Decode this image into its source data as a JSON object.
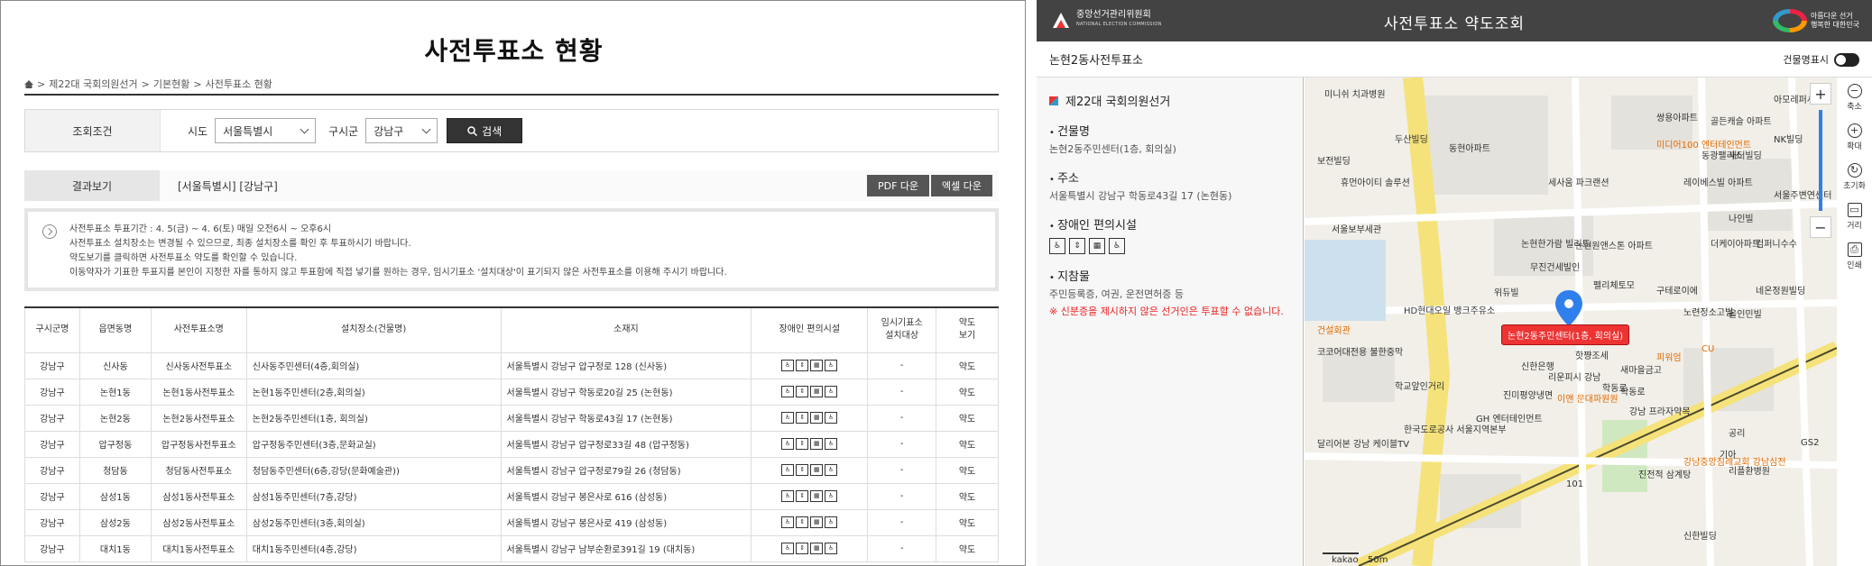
{
  "left": {
    "title": "사전투표소 현황",
    "breadcrumb": [
      "제22대 국회의원선거",
      "기본현황",
      "사전투표소 현황"
    ],
    "search": {
      "label": "조회조건",
      "sido_label": "시도",
      "sido_value": "서울특별시",
      "gusigun_label": "구시군",
      "gusigun_value": "강남구",
      "button": "검색"
    },
    "result": {
      "label": "결과보기",
      "value": "[서울특별시] [강남구]",
      "pdf": "PDF 다운",
      "excel": "엑셀 다운"
    },
    "notice": [
      "사전투표소 투표기간 : 4. 5(금) ~ 4. 6(토) 매일 오전6시 ~ 오후6시",
      "사전투표소 설치장소는 변경될 수 있으므로, 최종 설치장소를 확인 후 투표하시기 바랍니다.",
      "약도보기를 클릭하면 사전투표소 약도를 확인할 수 있습니다.",
      "이동약자가 기표한 투표지를 본인이 지정한 자를 통하지 않고 투표함에 직접 넣기를 원하는 경우, 임시기표소 '설치대상'이 표기되지 않은 사전투표소를 이용해 주시기 바랍니다."
    ],
    "table": {
      "headers": [
        "구시군명",
        "읍면동명",
        "사전투표소명",
        "설치장소(건물명)",
        "소재지",
        "장애인 편의시설",
        "임시기표소\n설치대상",
        "약도\n보기"
      ],
      "rows": [
        [
          "강남구",
          "신사동",
          "신사동사전투표소",
          "신사동주민센터(4층,회의실)",
          "서울특별시 강남구 압구정로 128 (신사동)",
          "-",
          "약도"
        ],
        [
          "강남구",
          "논현1동",
          "논현1동사전투표소",
          "논현1동주민센터(2층,회의실)",
          "서울특별시 강남구 학동로20길 25 (논현동)",
          "-",
          "약도"
        ],
        [
          "강남구",
          "논현2동",
          "논현2동사전투표소",
          "논현2동주민센터(1층, 회의실)",
          "서울특별시 강남구 학동로43길 17 (논현동)",
          "-",
          "약도"
        ],
        [
          "강남구",
          "압구정동",
          "압구정동사전투표소",
          "압구정동주민센터(3층,문화교실)",
          "서울특별시 강남구 압구정로33길 48 (압구정동)",
          "-",
          "약도"
        ],
        [
          "강남구",
          "청담동",
          "청담동사전투표소",
          "청담동주민센터(6층,강당(문화예술관))",
          "서울특별시 강남구 압구정로79길 26 (청담동)",
          "-",
          "약도"
        ],
        [
          "강남구",
          "삼성1동",
          "삼성1동사전투표소",
          "삼성1동주민센터(7층,강당)",
          "서울특별시 강남구 봉은사로 616 (삼성동)",
          "-",
          "약도"
        ],
        [
          "강남구",
          "삼성2동",
          "삼성2동사전투표소",
          "삼성2동주민센터(3층,회의실)",
          "서울특별시 강남구 봉은사로 419 (삼성동)",
          "-",
          "약도"
        ],
        [
          "강남구",
          "대치1동",
          "대치1동사전투표소",
          "대치1동주민센터(4층,강당)",
          "서울특별시 강남구 남부순환로391길 19 (대치동)",
          "-",
          "약도"
        ]
      ]
    }
  },
  "right": {
    "logo_text": "중앙선거관리위원회",
    "logo_sub": "NATIONAL ELECTION COMMISSION",
    "header_title": "사전투표소 약도조회",
    "header_right": [
      "아름다운 선거",
      "행복한 대한민국"
    ],
    "place_name": "논현2동사전투표소",
    "toggle_label": "건물명표시",
    "election": "제22대 국회의원선거",
    "building_h": "건물명",
    "building_v": "논현2동주민센터(1층, 회의실)",
    "address_h": "주소",
    "address_v": "서울특별시 강남구 학동로43길 17 (논현동)",
    "facility_h": "장애인 편의시설",
    "items_h": "지참물",
    "items_v": "주민등록증, 여권, 운전면허증 등",
    "warn": "※ 신분증을 제시하지 않은 선거인은 투표할 수 없습니다.",
    "pin_label": "논현2동주민센터(1층, 회의실)",
    "tools": [
      "축소",
      "확대",
      "초기화",
      "거리",
      "인쇄"
    ],
    "map_labels": [
      "미니쉬 치과병원",
      "두산빌딩",
      "동현아파트",
      "쌍용아파트",
      "골든캐슬 아파트",
      "동광팰리스",
      "새터빌딩",
      "NK빌딩",
      "보전빌딩",
      "휴먼아이티 솔루션",
      "세사움 파크랜션",
      "레이베스빌 아파트",
      "서울주변연센터",
      "나인빌",
      "서울보부세관",
      "논현한가람 빌리트",
      "논현원앤스톤 아파트",
      "더케이아파트",
      "컴퍼니수수",
      "무진건세빌인",
      "위듀빌",
      "펠리체토모",
      "구테로이에",
      "네온정원빌딩",
      "HD현대오일 뱅크주유소",
      "노련정소고빌",
      "올인민빌",
      "건설회관",
      "코코어대전용 불한중막",
      "신한은행",
      "핫쨩조세",
      "피워엄",
      "리운피시 강남",
      "새마을금고",
      "학교앞인거리",
      "진미평양냉면",
      "이앤 문대파원원",
      "강남 프라자약목",
      "GH 엔터테인먼트",
      "한국도로공사 서울지역본부",
      "달리어본 강남 케이블TV",
      "강남중앙침례교회 강남심전",
      "진전적 삼계탕",
      "리플환병원",
      "기아",
      "101",
      "신한빌딩",
      "미디어100 엔터테인먼트",
      "아모레퍼시픽",
      "학동로",
      "CU",
      "GS2",
      "공리",
      "kakao",
      "50m",
      "학동로"
    ]
  }
}
